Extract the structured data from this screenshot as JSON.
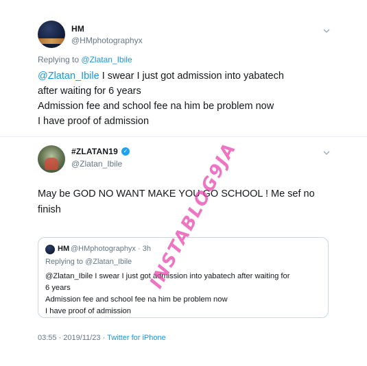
{
  "tweet": {
    "author_name": "HM",
    "author_handle": "@HMphotographyx",
    "replying_label": "Replying to",
    "replying_to": "@Zlatan_Ibile",
    "mention": "@Zlatan_Ibile",
    "lines": [
      " I swear I just got admission into yabatech",
      "after waiting for 6 years",
      "Admission fee and school fee na him be problem now",
      "I have proof of admission"
    ]
  },
  "reply": {
    "author_name": "#ZLATAN19",
    "author_handle": "@Zlatan_Ibile",
    "text": "May be GOD NO WANT MAKE YOU GO SCHOOL ! Me sef no finish",
    "quoted": {
      "author_name": "HM",
      "author_handle_time": "@HMphotographyx · 3h",
      "replying": "Replying to @Zlatan_Ibile",
      "lines": [
        "@Zlatan_Ibile I swear I just got admission into yabatech after waiting for",
        "6 years",
        "Admission fee and school fee na him be problem now",
        "I have proof of admission"
      ]
    },
    "timestamp": "03:55 · 2019/11/23 · ",
    "source": "Twitter for iPhone"
  },
  "watermark": "INSTABLOG9JA",
  "icons": {
    "chevron": "chevron-down-icon",
    "verified": "verified-badge-icon"
  },
  "colors": {
    "link": "#1b95e0",
    "muted": "#657786",
    "watermark": "#e840aa"
  }
}
